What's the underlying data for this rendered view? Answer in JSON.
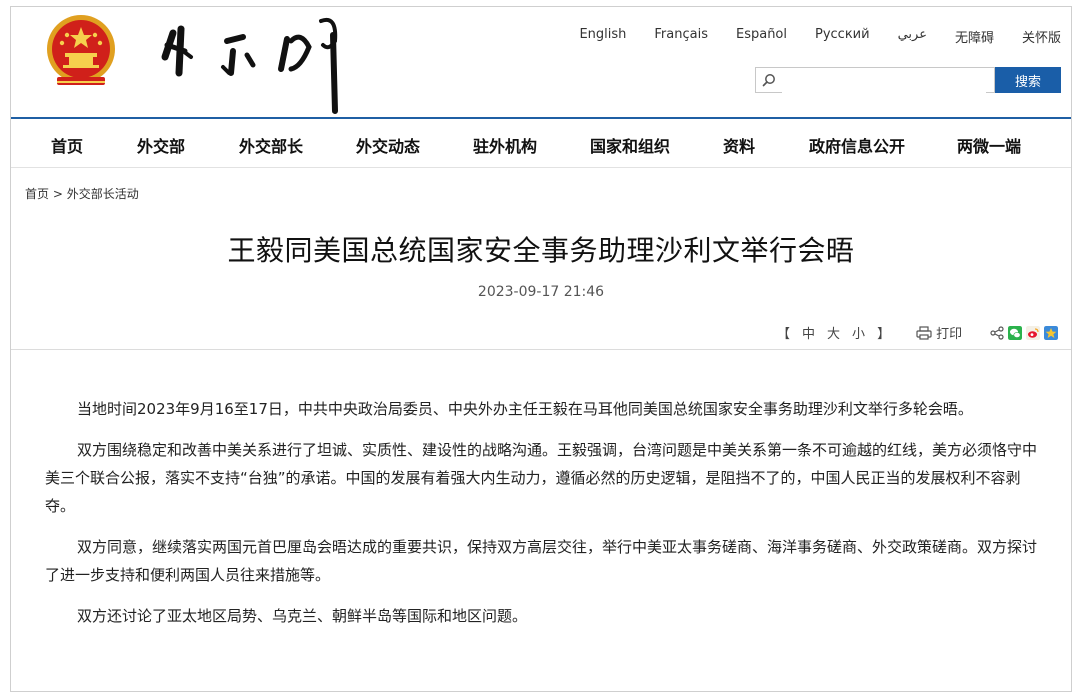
{
  "header": {
    "languages": [
      "English",
      "Français",
      "Español",
      "Русский",
      "عربي",
      "无障碍",
      "关怀版"
    ],
    "search": {
      "placeholder": "",
      "button_label": "搜索"
    }
  },
  "nav": {
    "items": [
      "首页",
      "外交部",
      "外交部长",
      "外交动态",
      "驻外机构",
      "国家和组织",
      "资料",
      "政府信息公开",
      "两微一端"
    ]
  },
  "breadcrumb": {
    "home": "首页",
    "separator": " > ",
    "section": "外交部长活动"
  },
  "article": {
    "title": "王毅同美国总统国家安全事务助理沙利文举行会晤",
    "date": "2023-09-17 21:46",
    "font_size": {
      "open": "【",
      "large": "中",
      "medium": "大",
      "small": "小",
      "close": "】"
    },
    "print_label": "打印",
    "paragraphs": [
      "当地时间2023年9月16至17日，中共中央政治局委员、中央外办主任王毅在马耳他同美国总统国家安全事务助理沙利文举行多轮会晤。",
      "双方围绕稳定和改善中美关系进行了坦诚、实质性、建设性的战略沟通。王毅强调，台湾问题是中美关系第一条不可逾越的红线，美方必须恪守中美三个联合公报，落实不支持“台独”的承诺。中国的发展有着强大内生动力，遵循必然的历史逻辑，是阻挡不了的，中国人民正当的发展权利不容剥夺。",
      "双方同意，继续落实两国元首巴厘岛会晤达成的重要共识，保持双方高层交往，举行中美亚太事务磋商、海洋事务磋商、外交政策磋商。双方探讨了进一步支持和便利两国人员往来措施等。",
      "双方还讨论了亚太地区局势、乌克兰、朝鲜半岛等国际和地区问题。"
    ]
  },
  "colors": {
    "brand_blue": "#1a5ea8",
    "emblem_red": "#d0201a",
    "emblem_gold": "#f2c230"
  },
  "icons": [
    "national-emblem-icon",
    "search-icon",
    "printer-icon",
    "share-icon",
    "wechat-icon",
    "weibo-icon",
    "qzone-icon"
  ]
}
